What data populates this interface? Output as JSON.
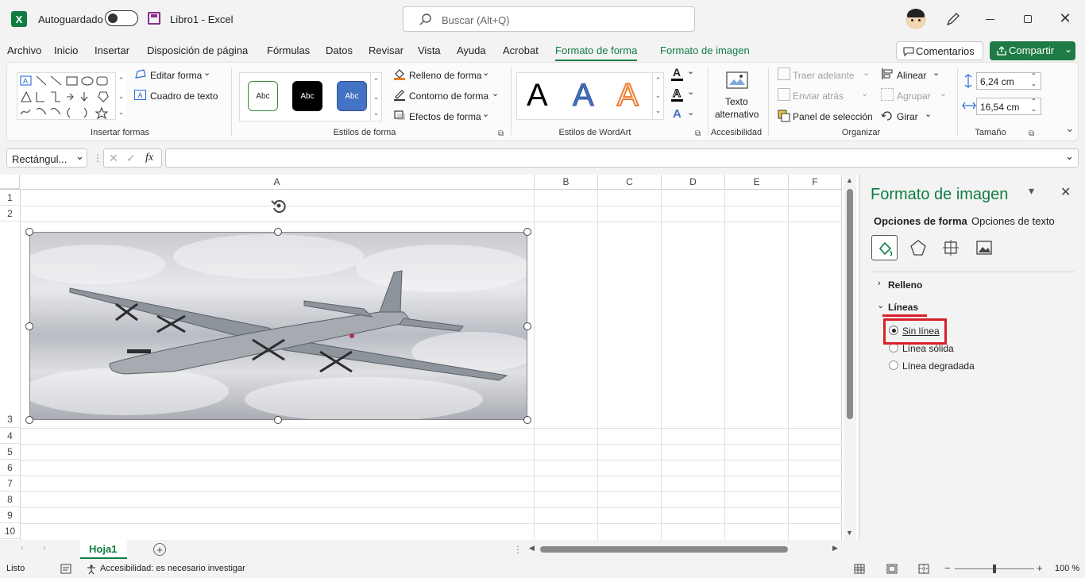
{
  "app": {
    "name": "Excel",
    "filename": "Libro1",
    "separator": "-"
  },
  "titlebar": {
    "autosave_label": "Autoguardado",
    "search_placeholder": "Buscar (Alt+Q)"
  },
  "menu": {
    "items": [
      "Archivo",
      "Inicio",
      "Insertar",
      "Disposición de página",
      "Fórmulas",
      "Datos",
      "Revisar",
      "Vista",
      "Ayuda",
      "Acrobat",
      "Formato de forma",
      "Formato de imagen"
    ],
    "active_index": 10,
    "comments_label": "Comentarios",
    "share_label": "Compartir"
  },
  "ribbon": {
    "insert_shapes": {
      "label": "Insertar formas",
      "edit_shape": "Editar forma",
      "text_box": "Cuadro de texto"
    },
    "shape_styles": {
      "label": "Estilos de forma",
      "sample": "Abc",
      "fill": "Relleno de forma",
      "outline": "Contorno de forma",
      "effects": "Efectos de forma"
    },
    "wordart": {
      "label": "Estilos de WordArt",
      "letter": "A"
    },
    "accessibility": {
      "label": "Accesibilidad",
      "alt_text_line1": "Texto",
      "alt_text_line2": "alternativo"
    },
    "arrange": {
      "label": "Organizar",
      "bring_forward": "Traer adelante",
      "send_backward": "Enviar atrás",
      "selection_pane": "Panel de selección",
      "align": "Alinear",
      "group": "Agrupar",
      "rotate": "Girar"
    },
    "size": {
      "label": "Tamaño",
      "height": "6,24 cm",
      "width": "16,54 cm"
    }
  },
  "formula_bar": {
    "name_box": "Rectángul...",
    "fx": "fx",
    "value": ""
  },
  "grid": {
    "columns": [
      "A",
      "B",
      "C",
      "D",
      "E",
      "F"
    ],
    "rows": [
      "1",
      "2",
      "3",
      "4",
      "5",
      "6",
      "7",
      "8",
      "9",
      "10"
    ]
  },
  "format_pane": {
    "title": "Formato de imagen",
    "tab_shape": "Opciones de forma",
    "tab_text": "Opciones de texto",
    "section_fill": "Relleno",
    "section_lines": "Líneas",
    "options": [
      "Sin línea",
      "Línea sólida",
      "Línea degradada"
    ],
    "selected_index": 0,
    "highlight_color": "#d9202a"
  },
  "sheet": {
    "tab_label": "Hoja1"
  },
  "status": {
    "ready": "Listo",
    "accessibility": "Accesibilidad: es necesario investigar",
    "zoom": "100 %"
  },
  "colors": {
    "excel_green": "#107c41",
    "share_bg": "#1e7b45"
  }
}
